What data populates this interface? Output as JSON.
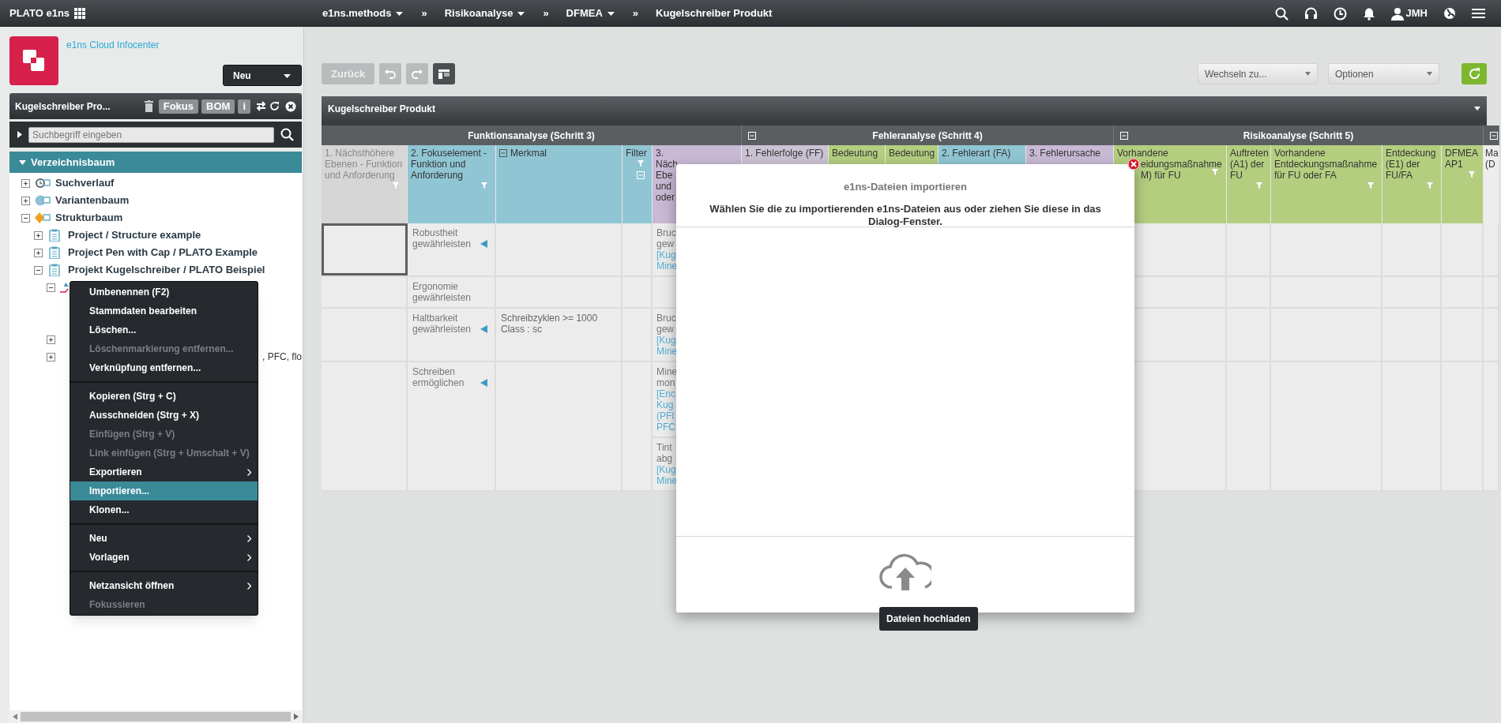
{
  "top_bar": {
    "app_title": "PLATO e1ns",
    "breadcrumbs": [
      {
        "label": "e1ns.methods",
        "dropdown": true
      },
      {
        "prefix": "»",
        "label": "Risikoanalyse",
        "dropdown": true
      },
      {
        "prefix": "»",
        "label": "DFMEA",
        "dropdown": true
      },
      {
        "prefix": "»",
        "label": "Kugelschreiber Produkt",
        "dropdown": false
      }
    ],
    "user": "JMH"
  },
  "sidebar": {
    "link": "e1ns Cloud Infocenter",
    "new_button": "Neu",
    "panel": {
      "title": "Kugelschreiber Pro...",
      "buttons": [
        "Fokus",
        "BOM",
        "i"
      ]
    },
    "search": {
      "placeholder": "Suchbegriff eingeben"
    },
    "tree_title": "Verzeichnisbaum",
    "tree_expanded": true,
    "tree": [
      {
        "kind": "history",
        "label": "Suchverlauf",
        "expanded": false
      },
      {
        "kind": "variants",
        "label": "Variantenbaum",
        "expanded": false
      },
      {
        "kind": "structure",
        "label": "Strukturbaum",
        "expanded": true,
        "children": [
          {
            "kind": "project",
            "label": "Project / Structure example",
            "expanded": false
          },
          {
            "kind": "project",
            "label": "Project Pen with Cap / PLATO Example",
            "expanded": false
          },
          {
            "kind": "project",
            "label": "Projekt Kugelschreiber / PLATO Beispiel",
            "expanded": true,
            "children": [
              {
                "kind": "product",
                "expanded": true
              },
              {
                "kind": "hidden",
                "expanded": false
              },
              {
                "kind": "tail",
                "label": ", PFC, flo",
                "expanded": false
              }
            ]
          }
        ]
      }
    ]
  },
  "context_menu": {
    "sections": [
      {
        "items": [
          {
            "label": "Umbenennen (F2)",
            "disabled": false,
            "submenu": false,
            "selected": false
          },
          {
            "label": "Stammdaten bearbeiten",
            "disabled": false,
            "submenu": false,
            "selected": false
          },
          {
            "label": "Löschen...",
            "disabled": false,
            "submenu": false,
            "selected": false
          },
          {
            "label": "Löschenmarkierung entfernen...",
            "disabled": true,
            "submenu": false,
            "selected": false
          },
          {
            "label": "Verknüpfung entfernen...",
            "disabled": false,
            "submenu": false,
            "selected": false
          }
        ]
      },
      {
        "items": [
          {
            "label": "Kopieren (Strg + C)",
            "disabled": false,
            "submenu": false,
            "selected": false
          },
          {
            "label": "Ausschneiden (Strg + X)",
            "disabled": false,
            "submenu": false,
            "selected": false
          },
          {
            "label": "Einfügen (Strg + V)",
            "disabled": true,
            "submenu": false,
            "selected": false
          },
          {
            "label": "Link einfügen (Strg + Umschalt + V)",
            "disabled": true,
            "submenu": false,
            "selected": false
          },
          {
            "label": "Exportieren",
            "disabled": false,
            "submenu": true,
            "selected": false
          },
          {
            "label": "Importieren...",
            "disabled": false,
            "submenu": false,
            "selected": true
          },
          {
            "label": "Klonen...",
            "disabled": false,
            "submenu": false,
            "selected": false
          }
        ]
      },
      {
        "items": [
          {
            "label": "Neu",
            "disabled": false,
            "submenu": true,
            "selected": false
          },
          {
            "label": "Vorlagen",
            "disabled": false,
            "submenu": true,
            "selected": false
          }
        ]
      },
      {
        "items": [
          {
            "label": "Netzansicht öffnen",
            "disabled": false,
            "submenu": true,
            "selected": false
          },
          {
            "label": "Fokussieren",
            "disabled": true,
            "submenu": false,
            "selected": false
          }
        ]
      }
    ]
  },
  "toolbar": {
    "back": "Zurück",
    "back_disabled": true,
    "switch_select": "Wechseln zu...",
    "options_select": "Optionen"
  },
  "panel": {
    "title": "Kugelschreiber Produkt"
  },
  "table": {
    "groups": [
      {
        "title": "Funktionsanalyse (Schritt 3)",
        "collapsible": false,
        "columns": [
          {
            "label": "1. Nächsthöhere Ebenen - Funktion und Anforderung",
            "color": "#d6d6d6",
            "muted": true,
            "filter": true,
            "collapse_icon": false
          },
          {
            "label": "2. Fokuselement - Funktion und Anforderung",
            "color": "#90c6d3",
            "muted": false,
            "filter": true,
            "collapse_icon": false
          },
          {
            "label": "Merkmal",
            "color": "#90c6d3",
            "muted": false,
            "filter": false,
            "collapse_icon": true
          },
          {
            "label": "Filter",
            "color": "#90c6d3",
            "muted": false,
            "filter": true,
            "collapse_icon": true
          },
          {
            "label": "3.\nNäch\nEbe\nund\noder",
            "color": "#c8b9d5",
            "muted": false
          }
        ]
      },
      {
        "title": "Fehleranalyse (Schritt 4)",
        "collapsible": true,
        "columns": [
          {
            "label": "1. Fehlerfolge (FF)",
            "color": "#cbc3d3",
            "muted": false,
            "collapse_icon": false
          },
          {
            "label": "Bedeutung",
            "color": "#b4ce80",
            "muted": false,
            "collapse_icon": false
          },
          {
            "label": "Bedeutung",
            "color": "#b4ce80",
            "muted": false,
            "collapse_icon": false
          },
          {
            "label": "2. Fehlerart (FA)",
            "color": "#90c6d3",
            "muted": false,
            "collapse_icon": false
          },
          {
            "label": "3. Fehlerursache",
            "color": "#c8b9d5",
            "muted": false,
            "collapse_icon": false
          }
        ]
      },
      {
        "title": "Risikoanalyse (Schritt 5)",
        "collapsible": true,
        "columns": [
          {
            "label": "Vorhandene\neidungsmaßnahme\nM) für FU",
            "color": "#b4ce80",
            "muted": false,
            "filter": true,
            "collapse_icon": false,
            "covered": true
          },
          {
            "label": "Auftreten (A1) der FU",
            "color": "#b4ce80",
            "muted": false,
            "filter": true,
            "collapse_icon": false
          },
          {
            "label": "Vorhandene Entdeckungsmaßnahme für FU oder FA",
            "color": "#b4ce80",
            "muted": false,
            "filter": true,
            "collapse_icon": false
          },
          {
            "label": "Entdeckung (E1) der FU/FA",
            "color": "#b4ce80",
            "muted": false,
            "filter": true,
            "collapse_icon": false
          },
          {
            "label": "DFMEA AP1",
            "color": "#b4ce80",
            "muted": false,
            "filter": true,
            "collapse_icon": false
          }
        ]
      },
      {
        "collapsible": true,
        "columns": [
          {
            "label": "Ma\n(D",
            "color": "#ededed",
            "muted": false,
            "filter": false,
            "collapse_icon": false
          }
        ]
      }
    ],
    "rows": [
      {
        "first_cell_selected": true,
        "function": "Robustheit gewährleisten",
        "linked": true,
        "next_level": [
          {
            "lines": [
              {
                "text": "Bruc",
                "link": false
              },
              {
                "text": "gew",
                "link": false
              },
              {
                "text": "[Kug",
                "link": true
              },
              {
                "text": "Mine",
                "link": true
              }
            ]
          }
        ]
      },
      {
        "first_cell_selected": false,
        "function": "Ergonomie gewährleisten",
        "linked": false
      },
      {
        "first_cell_selected": false,
        "function": "Haltbarkeit gewährleisten",
        "linked": true,
        "characteristic": [
          "Schreibzyklen >= 1000",
          "Class : sc"
        ],
        "next_level": [
          {
            "lines": [
              {
                "text": "Bruc",
                "link": false
              },
              {
                "text": "gew",
                "link": false
              },
              {
                "text": "[Kug",
                "link": true
              },
              {
                "text": "Mine",
                "link": true
              }
            ]
          }
        ]
      },
      {
        "first_cell_selected": false,
        "function": "Schreiben ermöglichen",
        "linked": true,
        "next_level": [
          {
            "lines": [
              {
                "text": "Mine",
                "link": false
              },
              {
                "text": "mon",
                "link": false
              },
              {
                "text": "[Enc",
                "link": true
              },
              {
                "text": "Kug",
                "link": true
              },
              {
                "text": "(PFI",
                "link": true
              },
              {
                "text": "PFC",
                "link": true
              }
            ]
          },
          {
            "lines": [
              {
                "text": "Tint",
                "link": false
              },
              {
                "text": "abg",
                "link": false
              },
              {
                "text": "[Kug",
                "link": true
              },
              {
                "text": "Mine",
                "link": true
              }
            ]
          }
        ]
      }
    ]
  },
  "dialog": {
    "title": "e1ns-Dateien importieren",
    "instruction": "Wählen Sie die zu importierenden e1ns-Dateien aus oder ziehen Sie diese in das Dialog-Fenster.",
    "tooltip": "Dateien hochladen"
  }
}
